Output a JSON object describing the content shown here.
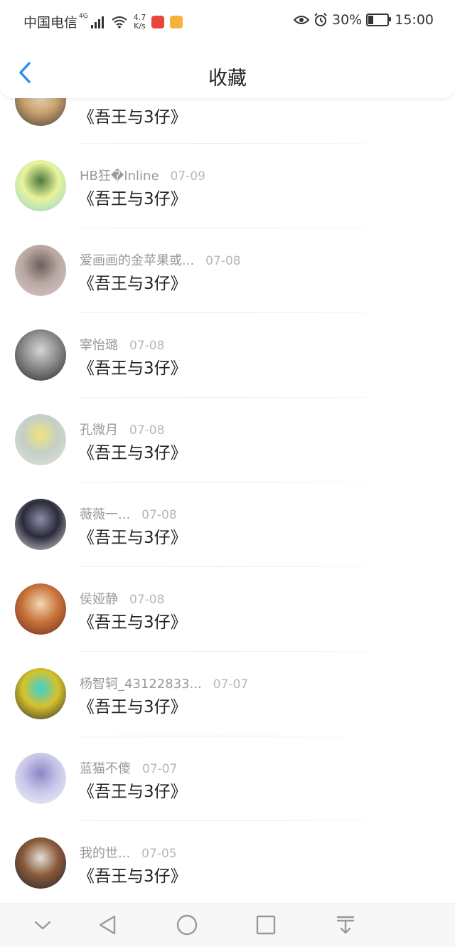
{
  "status_bar": {
    "carrier": "中国电信",
    "network": "4G",
    "speed_value": "4.7",
    "speed_unit": "K/s",
    "battery": "30%",
    "battery_level": 0.3,
    "time": "15:00"
  },
  "header": {
    "title": "收藏"
  },
  "favorites": [
    {
      "name": "",
      "date": "",
      "book": "《吾王与3仔》",
      "avatar_colors": [
        "#3b3b3b",
        "#c9a06d",
        "#e7d9c4"
      ]
    },
    {
      "name": "HB狂�Inline",
      "date": "07-09",
      "book": "《吾王与3仔》",
      "avatar_colors": [
        "#8fd3d6",
        "#e9f39b",
        "#4a7a3c"
      ]
    },
    {
      "name": "爱画画的金苹果或...",
      "date": "07-08",
      "book": "《吾王与3仔》",
      "avatar_colors": [
        "#d8cbc6",
        "#b9a7a2",
        "#6b5e5b"
      ]
    },
    {
      "name": "宰怡璐",
      "date": "07-08",
      "book": "《吾王与3仔》",
      "avatar_colors": [
        "#2b2b2b",
        "#8a8a8a",
        "#d6d6d6"
      ]
    },
    {
      "name": "孔微月",
      "date": "07-08",
      "book": "《吾王与3仔》",
      "avatar_colors": [
        "#dfe3df",
        "#c3cfc7",
        "#f2e47a"
      ]
    },
    {
      "name": "薇薇一...",
      "date": "07-08",
      "book": "《吾王与3仔》",
      "avatar_colors": [
        "#dcdce6",
        "#2a2a3a",
        "#8e8ea8"
      ]
    },
    {
      "name": "侯娅静",
      "date": "07-08",
      "book": "《吾王与3仔》",
      "avatar_colors": [
        "#6b2b1b",
        "#c9733a",
        "#f0d9b5"
      ]
    },
    {
      "name": "杨智轲_43122833...",
      "date": "07-07",
      "book": "《吾王与3仔》",
      "avatar_colors": [
        "#2c2c30",
        "#d7c22a",
        "#3ad0d8"
      ]
    },
    {
      "name": "蓝猫不傻",
      "date": "07-07",
      "book": "《吾王与3仔》",
      "avatar_colors": [
        "#f4f4fa",
        "#c8c6e8",
        "#8a86c8"
      ]
    },
    {
      "name": "我的世...",
      "date": "07-05",
      "book": "《吾王与3仔》",
      "avatar_colors": [
        "#1e2230",
        "#8a5a3a",
        "#e6e0d8"
      ]
    }
  ],
  "navbar": {
    "buttons": [
      "collapse-icon",
      "back-triangle-icon",
      "home-circle-icon",
      "recents-square-icon",
      "notification-pull-icon"
    ]
  },
  "colors": {
    "accent": "#2f8fe8",
    "name_text": "#999999",
    "date_text": "#b7b7b7"
  }
}
